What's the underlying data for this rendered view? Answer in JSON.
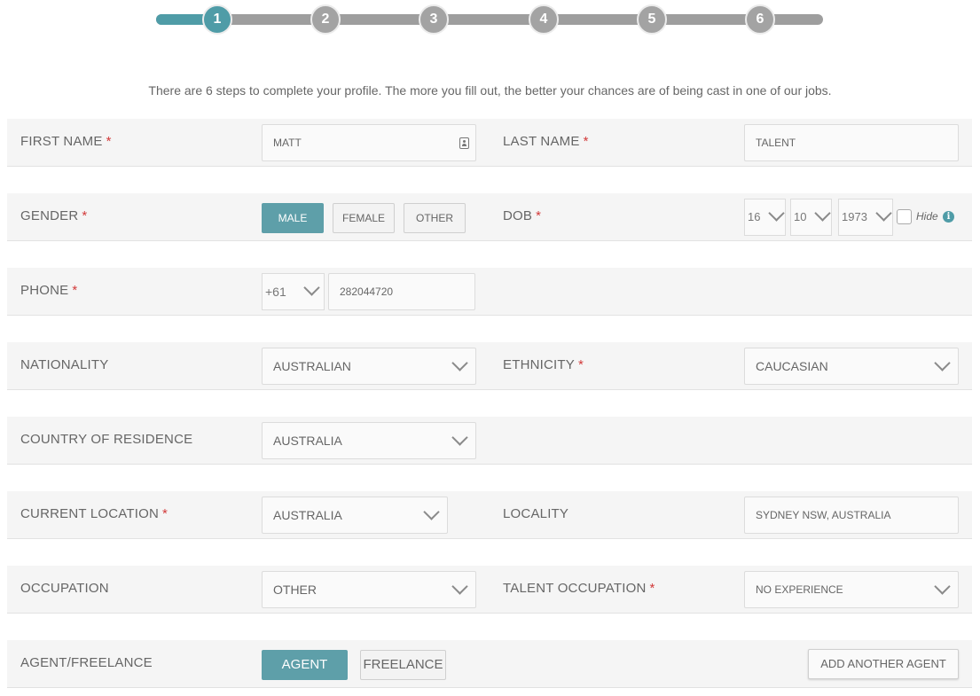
{
  "progress": {
    "steps": [
      "1",
      "2",
      "3",
      "4",
      "5",
      "6"
    ],
    "active_step": "1"
  },
  "intro": "There are 6 steps to complete your profile. The more you fill out, the better your chances are of being cast in one of our jobs.",
  "colors": {
    "accent": "#4f9ca7",
    "required": "#d23a3a",
    "step_inactive": "#a3a3a3"
  },
  "form": {
    "first_name": {
      "label": "FIRST NAME",
      "required": "*",
      "value": "MATT",
      "icon": "contact-card-icon"
    },
    "last_name": {
      "label": "LAST NAME",
      "required": "*",
      "value": "TALENT"
    },
    "gender": {
      "label": "GENDER",
      "required": "*",
      "options": [
        "MALE",
        "FEMALE",
        "OTHER"
      ],
      "selected": "MALE"
    },
    "dob": {
      "label": "DOB",
      "required": "*",
      "day": "16",
      "month": "10",
      "year": "1973",
      "hide_label": "Hide",
      "hide_checked": false,
      "info_icon": "info-icon",
      "info_glyph": "i"
    },
    "phone": {
      "label": "PHONE",
      "required": "*",
      "code": "+61",
      "number": "282044720"
    },
    "nationality": {
      "label": "NATIONALITY",
      "value": "AUSTRALIAN"
    },
    "ethnicity": {
      "label": "ETHNICITY",
      "required": "*",
      "value": "CAUCASIAN"
    },
    "country_of_residence": {
      "label": "COUNTRY OF RESIDENCE",
      "value": "AUSTRALIA"
    },
    "current_location": {
      "label": "CURRENT LOCATION",
      "required": "*",
      "value": "AUSTRALIA"
    },
    "locality": {
      "label": "LOCALITY",
      "value": "SYDNEY NSW, AUSTRALIA"
    },
    "occupation": {
      "label": "OCCUPATION",
      "value": "OTHER"
    },
    "talent_occupation": {
      "label": "TALENT OCCUPATION",
      "required": "*",
      "value": "NO EXPERIENCE"
    },
    "agent_freelance": {
      "label": "AGENT/FREELANCE",
      "options": [
        "AGENT",
        "FREELANCE"
      ],
      "selected": "AGENT",
      "add_agent": "ADD ANOTHER AGENT"
    }
  }
}
